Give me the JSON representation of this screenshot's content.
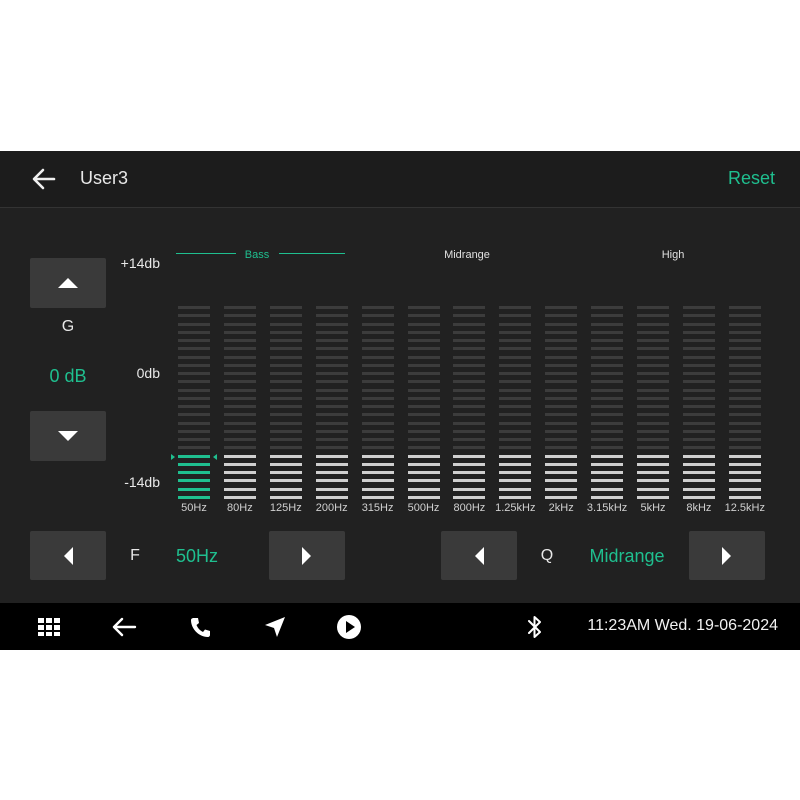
{
  "theme": {
    "accent": "#1fbf8f",
    "active_bar": "#1fbf8f",
    "inactive_bar": "#cfcfcf",
    "empty_bar": "#3c3c3c"
  },
  "header": {
    "title": "User3",
    "reset_label": "Reset"
  },
  "gain": {
    "label": "G",
    "value": "0 dB",
    "scale_top": "+14db",
    "scale_mid": "0db",
    "scale_bottom": "-14db"
  },
  "eq": {
    "regions": {
      "bass": "Bass",
      "midrange": "Midrange",
      "high": "High"
    },
    "bands": [
      {
        "freq": "50Hz",
        "level_db": -7
      },
      {
        "freq": "80Hz",
        "level_db": -7
      },
      {
        "freq": "125Hz",
        "level_db": -7
      },
      {
        "freq": "200Hz",
        "level_db": -7
      },
      {
        "freq": "315Hz",
        "level_db": -7
      },
      {
        "freq": "500Hz",
        "level_db": -7
      },
      {
        "freq": "800Hz",
        "level_db": -7
      },
      {
        "freq": "1.25kHz",
        "level_db": -7
      },
      {
        "freq": "2kHz",
        "level_db": -7
      },
      {
        "freq": "3.15kHz",
        "level_db": -7
      },
      {
        "freq": "5kHz",
        "level_db": -7
      },
      {
        "freq": "8kHz",
        "level_db": -7
      },
      {
        "freq": "12.5kHz",
        "level_db": -7
      }
    ],
    "selected_band_index": 0,
    "range_db": [
      -14,
      14
    ]
  },
  "freq_control": {
    "label": "F",
    "value": "50Hz"
  },
  "q_control": {
    "label": "Q",
    "value": "Midrange"
  },
  "taskbar": {
    "clock": "11:23AM Wed. 19-06-2024"
  }
}
